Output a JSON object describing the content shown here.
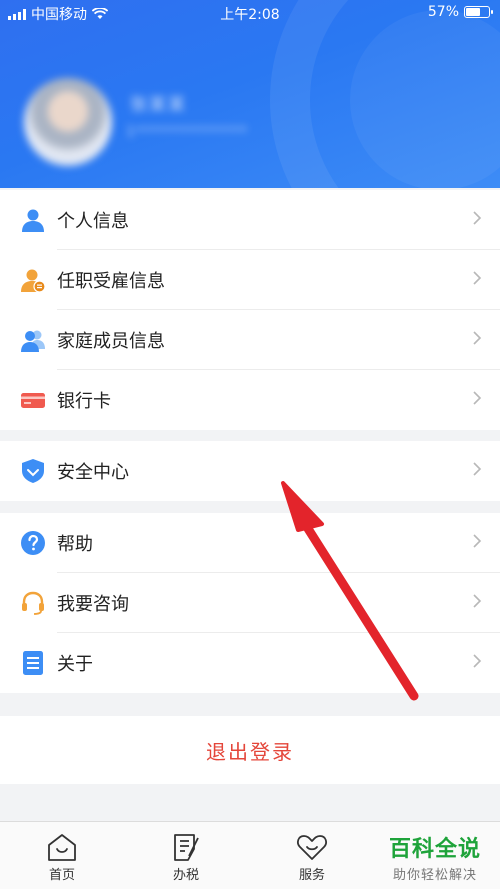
{
  "status_bar": {
    "carrier": "中国移动",
    "time": "上午2:08",
    "battery": "57%",
    "battery_level": 0.57
  },
  "profile": {
    "name": "张某某",
    "id_masked": "1**************"
  },
  "menu_group_1": [
    {
      "label": "个人信息",
      "icon": "person-icon"
    },
    {
      "label": "任职受雇信息",
      "icon": "employment-icon"
    },
    {
      "label": "家庭成员信息",
      "icon": "family-icon"
    },
    {
      "label": "银行卡",
      "icon": "bank-card-icon"
    }
  ],
  "menu_group_2": [
    {
      "label": "安全中心",
      "icon": "shield-icon"
    }
  ],
  "menu_group_3": [
    {
      "label": "帮助",
      "icon": "help-icon"
    },
    {
      "label": "我要咨询",
      "icon": "headset-icon"
    },
    {
      "label": "关于",
      "icon": "document-icon"
    }
  ],
  "logout_label": "退出登录",
  "tabs": [
    {
      "label": "首页",
      "icon": "home-icon"
    },
    {
      "label": "办税",
      "icon": "tax-icon"
    },
    {
      "label": "服务",
      "icon": "service-icon"
    }
  ],
  "watermark": {
    "title": "百科全说",
    "subtitle": "助你轻松解决"
  },
  "colors": {
    "header_blue": "#2a78f2",
    "logout_red": "#e4463a",
    "arrow_red": "#e3242b",
    "watermark_green": "#1ea33a"
  }
}
